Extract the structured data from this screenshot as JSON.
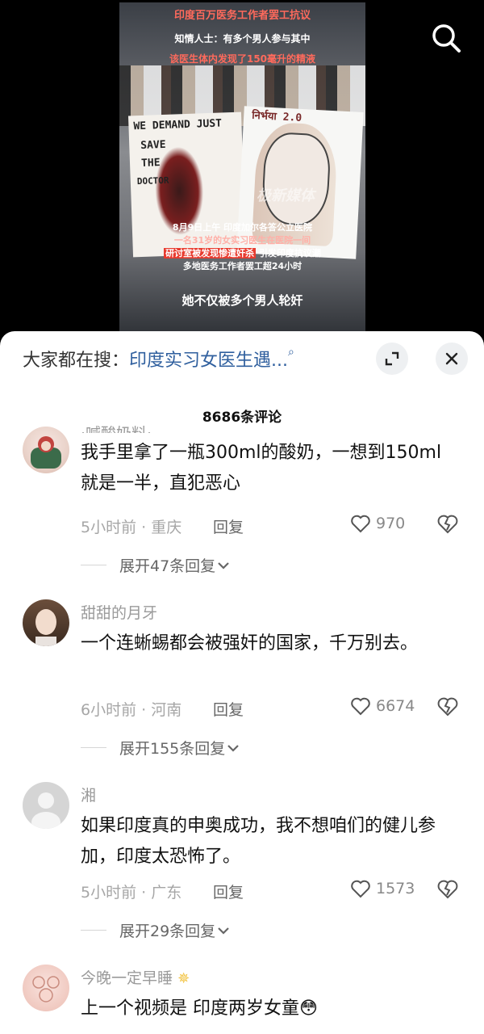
{
  "video": {
    "overlay_top": [
      "印度百万医务工作者罢工抗议",
      "知情人士：有多个男人参与其中",
      "该医生体内发现了150毫升的精液"
    ],
    "sign_left_text": [
      "WE DEMAND JUST",
      "SAVE",
      "THE",
      "DOCTOR"
    ],
    "sign_right_text": "निर्भया 2.0",
    "watermark": "极新媒体",
    "caption_lines": [
      "8月9日上午 印度加尔各答公立医院",
      "一名31岁的女实习医生在医院一间",
      "研讨室被发现惨遭奸杀",
      "引发印度抗议潮",
      "多地医务工作者罢工超24小时"
    ],
    "subtitle": "她不仅被多个男人轮奸"
  },
  "hot_search": {
    "prefix": "大家都在搜：",
    "query": "印度实习女医生遇..."
  },
  "comments_header": {
    "count_label": "8686条评论"
  },
  "comments": [
    {
      "username": "·喊酸奶料·",
      "text": "我手里拿了一瓶300ml的酸奶，一想到150ml就是一半，直犯恶心",
      "time_location": "5小时前 · 重庆",
      "reply_label": "回复",
      "likes": "970",
      "expand_label": "展开47条回复"
    },
    {
      "username": "甜甜的月牙",
      "text": "一个连蜥蜴都会被强奸的国家，千万别去。",
      "time_location": "6小时前 · 河南",
      "reply_label": "回复",
      "likes": "6674",
      "expand_label": "展开155条回复"
    },
    {
      "username": "湘",
      "text": "如果印度真的申奥成功，我不想咱们的健儿参加，印度太恐怖了。",
      "time_location": "5小时前 · 广东",
      "reply_label": "回复",
      "likes": "1573",
      "expand_label": "展开29条回复"
    },
    {
      "username": "今晚一定早睡",
      "text": "上一个视频是 印度两岁女童😳",
      "time_location": "",
      "reply_label": "",
      "likes": "",
      "expand_label": ""
    }
  ],
  "icons": {
    "search": "search-icon",
    "expand": "fullscreen-icon",
    "close": "close-icon",
    "like": "heart-outline-icon",
    "dislike": "broken-heart-icon",
    "chevron": "chevron-down-icon"
  },
  "colors": {
    "link": "#2f5f9e",
    "overlay_pink": "#ff6a5c",
    "highlight_red": "#e83b2f"
  }
}
